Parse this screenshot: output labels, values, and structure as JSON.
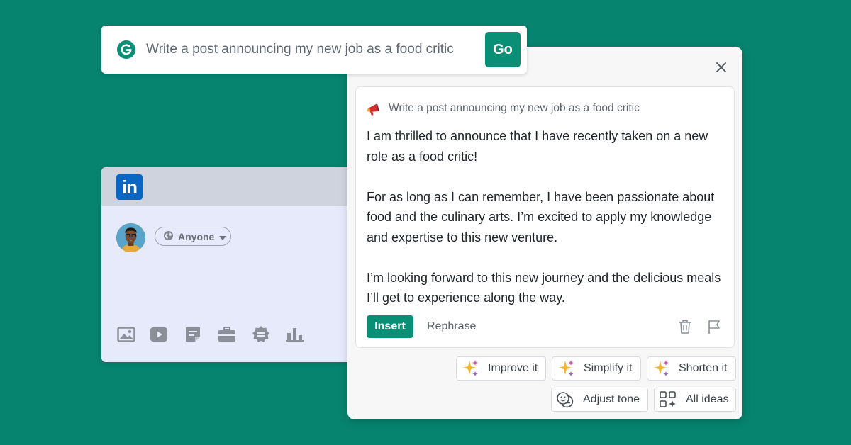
{
  "prompt_bar": {
    "logo_icon": "grammarly-g-icon",
    "text": "Write a post announcing my new job as a food critic",
    "go_label": "Go"
  },
  "linkedin": {
    "logo_text": "in",
    "audience_label": "Anyone",
    "toolbar_icons": [
      "image-icon",
      "video-icon",
      "document-icon",
      "job-briefcase-icon",
      "badge-icon",
      "poll-chart-icon"
    ]
  },
  "panel": {
    "prompt_echo": "Write a post announcing my new job as a food critic",
    "response_paragraphs": [
      "I am thrilled to announce that I have recently taken on a new role as a food critic!",
      "For as long as I can remember, I have been passionate about food and the culinary arts. I’m excited to apply my knowledge and expertise to this new venture.",
      "I’m looking forward to this new journey and the delicious meals I’ll get to experience along the way."
    ],
    "insert_label": "Insert",
    "rephrase_label": "Rephrase",
    "suggestions": {
      "improve": "Improve it",
      "simplify": "Simplify it",
      "shorten": "Shorten it",
      "adjust_tone": "Adjust tone",
      "all_ideas": "All ideas"
    }
  },
  "colors": {
    "background": "#06846f",
    "accent": "#0a8f77",
    "linkedin_blue": "#0a66c2"
  }
}
